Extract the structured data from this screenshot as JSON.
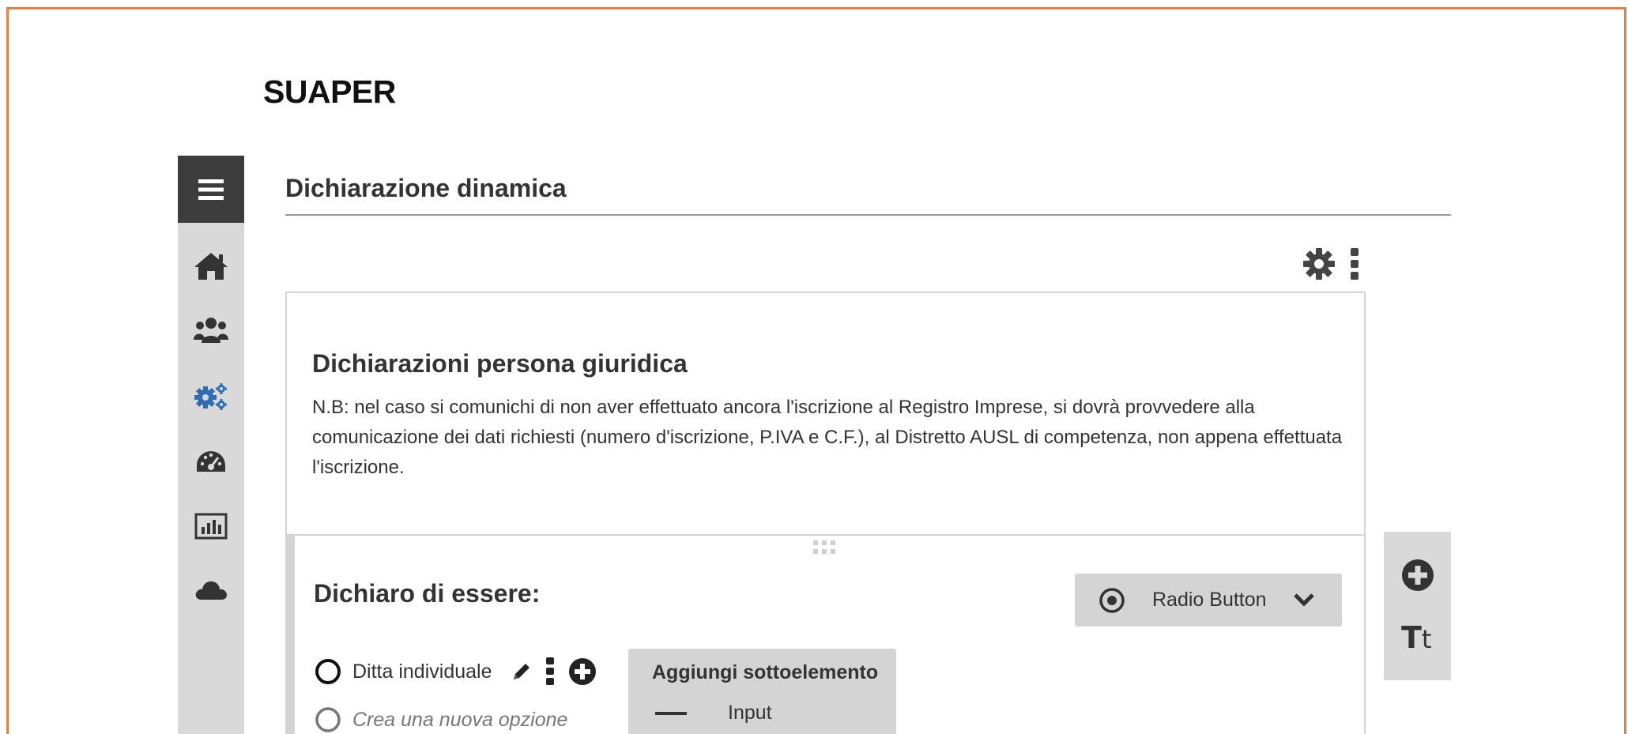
{
  "app": {
    "brand": "SUAPER"
  },
  "sidebar": {
    "items": [
      {
        "icon": "home-icon",
        "active": false
      },
      {
        "icon": "users-icon",
        "active": false
      },
      {
        "icon": "gears-icon",
        "active": true
      },
      {
        "icon": "dashboard-icon",
        "active": false
      },
      {
        "icon": "chart-icon",
        "active": false
      },
      {
        "icon": "cloud-icon",
        "active": false
      }
    ],
    "active_color": "#2f6db5"
  },
  "page": {
    "title": "Dichiarazione dinamica"
  },
  "section": {
    "heading": "Dichiarazioni persona giuridica",
    "note": "N.B: nel caso si comunichi di non aver effettuato ancora l'iscrizione al Registro Imprese, si dovrà provvedere alla comunicazione dei dati richiesti (numero d'iscrizione, P.IVA e C.F.), al Distretto AUSL di competenza, non appena effettuata l'iscrizione."
  },
  "question": {
    "title": "Dichiaro di essere:",
    "type_label": "Radio Button",
    "options": [
      {
        "label": "Ditta individuale"
      }
    ],
    "new_option_placeholder": "Crea una nuova opzione"
  },
  "subelement_menu": {
    "title": "Aggiungi sottoelemento",
    "items": [
      {
        "label": "Input"
      }
    ]
  },
  "colors": {
    "frame_border": "#e87d4a",
    "sidebar_header": "#3c3c3c"
  }
}
